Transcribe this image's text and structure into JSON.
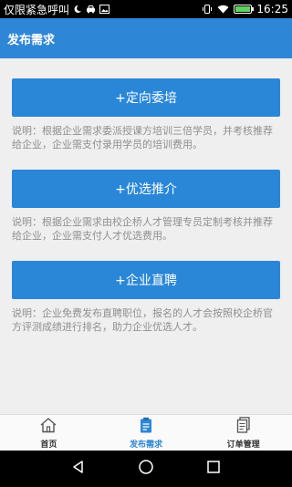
{
  "status_bar": {
    "carrier": "仅限紧急呼叫",
    "time": "16:25",
    "icons": [
      "moon-icon",
      "car-icon",
      "image-icon",
      "vibrate-icon",
      "wifi-icon",
      "battery-icon"
    ]
  },
  "header": {
    "title": "发布需求"
  },
  "options": [
    {
      "label": "+定向委培",
      "description": "说明：根据企业需求委派授课方培训三倍学员，并考核推荐给企业，企业需支付录用学员的培训费用。"
    },
    {
      "label": "+优选推介",
      "description": "说明：根据企业需求由校企桥人才管理专员定制考核并推荐给企业，企业需支付人才优选费用。"
    },
    {
      "label": "+企业直聘",
      "description": "说明：企业免费发布直聘职位，报名的人才会按照校企桥官方评测成绩进行排名，助力企业优选人才。"
    }
  ],
  "bottom_nav": {
    "items": [
      {
        "label": "首页",
        "icon": "home-icon",
        "active": false
      },
      {
        "label": "发布需求",
        "icon": "clipboard-icon",
        "active": true
      },
      {
        "label": "订单管理",
        "icon": "orders-icon",
        "active": false
      }
    ]
  },
  "colors": {
    "primary": "#2e86d6",
    "button": "#2a87d8",
    "background": "#efefef",
    "description_text": "#8f8f8f"
  }
}
